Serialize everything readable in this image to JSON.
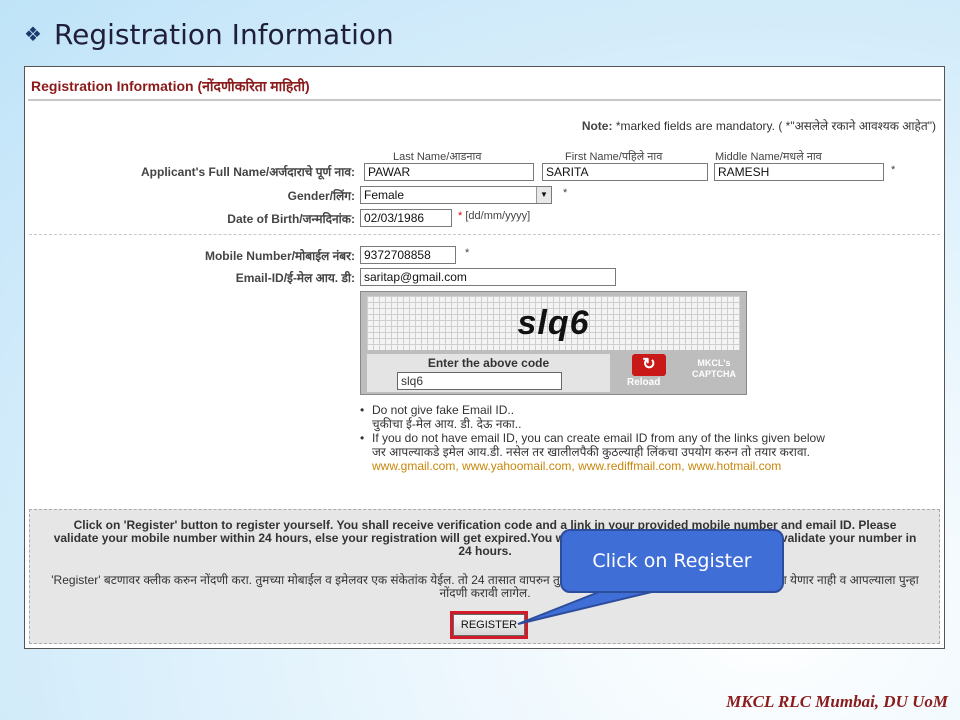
{
  "slide": {
    "bullet": "❖",
    "title": "Registration Information",
    "footer": "MKCL RLC Mumbai, DU UoM"
  },
  "form": {
    "heading": "Registration Information (नोंदणीकरिता माहिती)",
    "note_label": "Note:",
    "note_text": " *marked fields are mandatory. ( *\"असलेले रकाने आवश्यक आहेत\")",
    "name": {
      "label": "Applicant's Full Name/अर्जदाराचे पूर्ण नाव:",
      "last_caption": "Last Name/आडनाव",
      "first_caption": "First Name/पहिले नाव",
      "middle_caption": "Middle Name/मधले नाव",
      "last_value": "PAWAR",
      "first_value": "SARITA",
      "middle_value": "RAMESH"
    },
    "gender": {
      "label": "Gender/लिंग:",
      "value": "Female"
    },
    "dob": {
      "label": "Date of Birth/जन्मदिनांक:",
      "value": "02/03/1986",
      "format": "[dd/mm/yyyy]"
    },
    "mobile": {
      "label": "Mobile Number/मोबाईल नंबर:",
      "value": "9372708858"
    },
    "email": {
      "label": "Email-ID/ई-मेल आय. डी:",
      "value": "saritap@gmail.com"
    },
    "required_mark": "*",
    "captcha": {
      "code_image_text": "slq6",
      "enter_label": "Enter the above code",
      "input_value": "slq6",
      "reload_label": "Reload",
      "brand": "MKCL's CAPTCHA"
    },
    "tips": {
      "tip1_en": "Do not give fake Email ID..",
      "tip1_mr": "चुकीचा ई-मेल आय. डी. देऊ नका..",
      "tip2_en": "If you do not have email ID, you can create email ID from any of the links given below",
      "tip2_mr": "जर आपल्याकडे इमेल आय.डी. नसेल तर खालीलपैकी कुठल्याही लिंकचा उपयोग करुन तो तयार करावा.",
      "links": [
        "www.gmail.com",
        "www.yahoomail.com",
        "www.rediffmail.com",
        "www.hotmail.com"
      ]
    },
    "register_panel": {
      "para_en": "Click on 'Register' button to register yourself. You shall receive verification code and a link in your provided mobile number and email ID. Please validate your mobile number within 24 hours, else your registration will get expired.You will have to register again if you do not validate your number in 24 hours.",
      "para_mr": "'Register' बटणावर क्लीक करुन नोंदणी करा. तुमच्या मोबाईल व इमेलवर एक संकेतांक येईल. तो 24 तासात वापरुन तुमचा मोबाईल नंबर सुनिश्चित करा, अन्यथा तो वापरता येणार नाही व आपल्याला पुन्हा नोंदणी करावी लागेल.",
      "button_label": "REGISTER"
    }
  },
  "callout": {
    "text": "Click on Register"
  }
}
